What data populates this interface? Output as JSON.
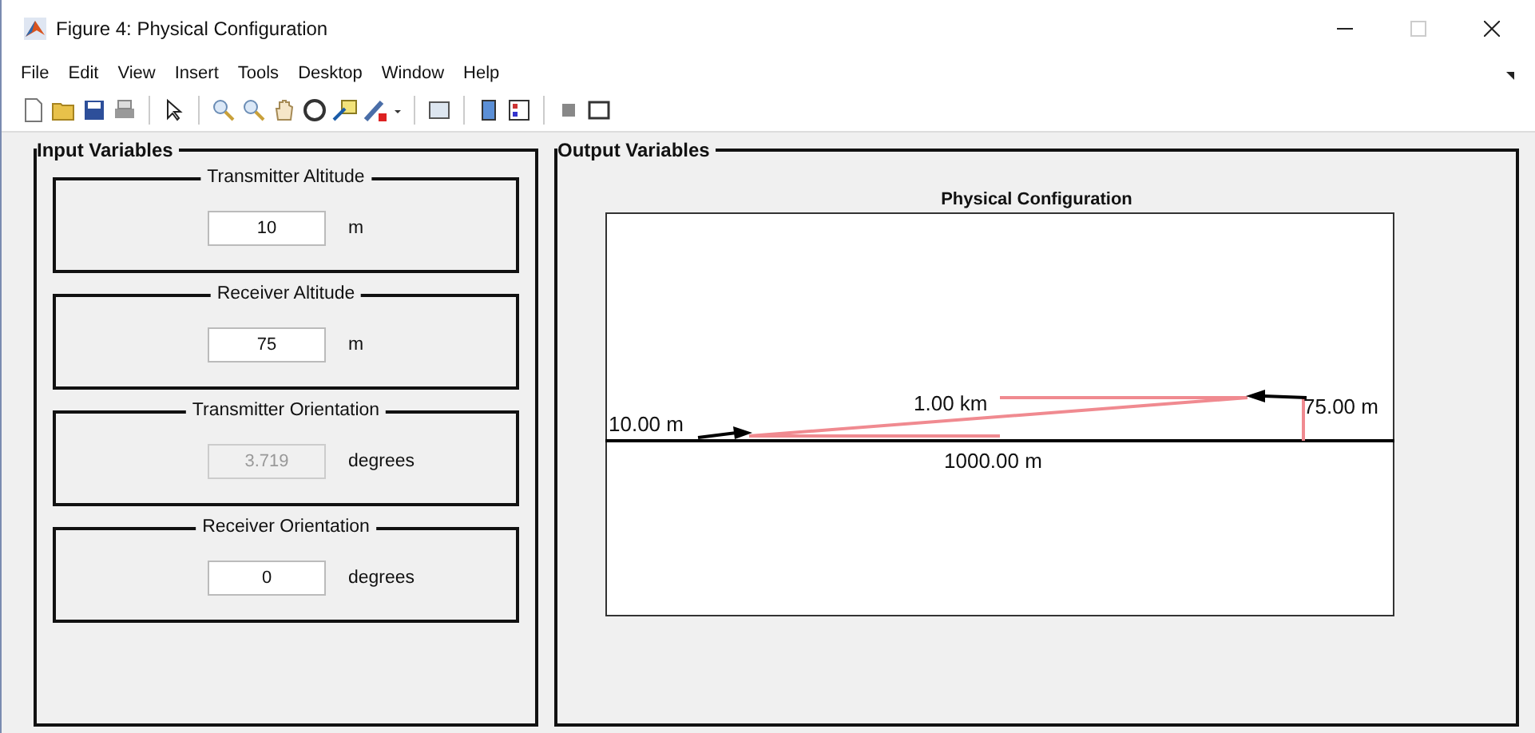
{
  "window": {
    "title": "Figure 4: Physical Configuration"
  },
  "menu": [
    "File",
    "Edit",
    "View",
    "Insert",
    "Tools",
    "Desktop",
    "Window",
    "Help"
  ],
  "input_panel": {
    "title": "Input Variables",
    "groups": [
      {
        "title": "Transmitter Altitude",
        "value": "10",
        "unit": "m",
        "disabled": false
      },
      {
        "title": "Receiver Altitude",
        "value": "75",
        "unit": "m",
        "disabled": false
      },
      {
        "title": "Transmitter Orientation",
        "value": "3.719",
        "unit": "degrees",
        "disabled": true
      },
      {
        "title": "Receiver Orientation",
        "value": "0",
        "unit": "degrees",
        "disabled": false
      }
    ]
  },
  "output_panel": {
    "title": "Output Variables",
    "plot": {
      "title": "Physical Configuration",
      "labels": {
        "tx_height": "10.00 m",
        "path_length": "1.00 km",
        "rx_height": "75.00 m",
        "distance": "1000.00 m"
      }
    }
  }
}
